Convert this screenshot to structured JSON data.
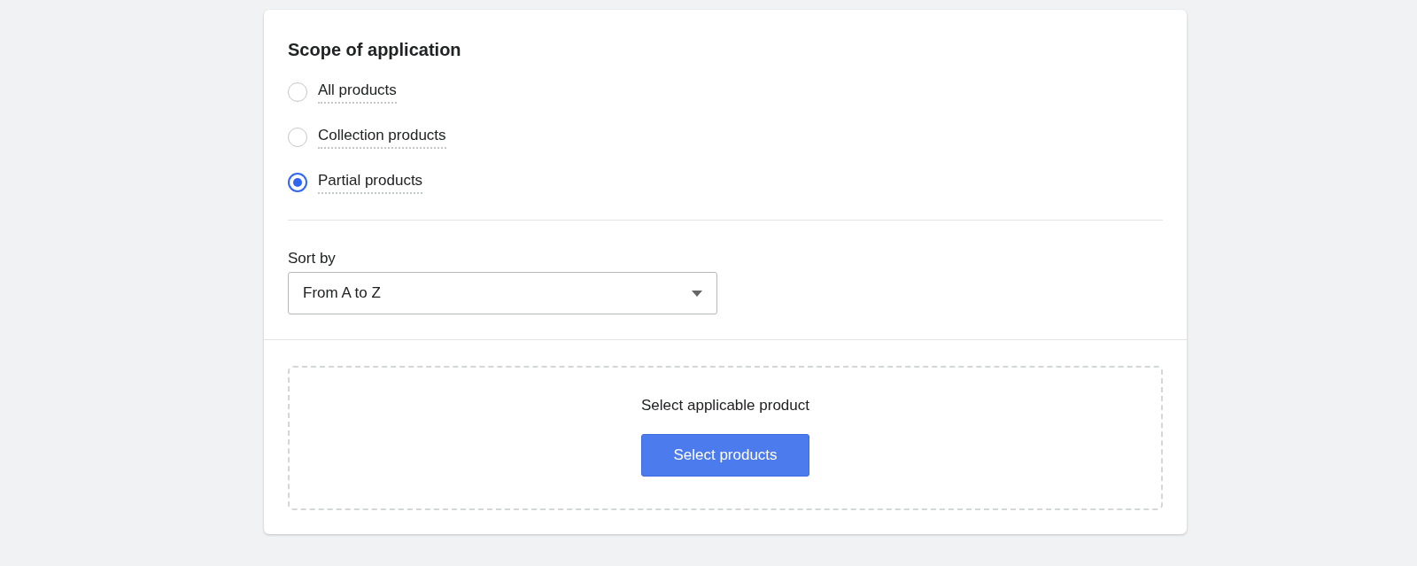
{
  "section": {
    "title": "Scope of application",
    "options": [
      {
        "label": "All products",
        "selected": false
      },
      {
        "label": "Collection products",
        "selected": false
      },
      {
        "label": "Partial products",
        "selected": true
      }
    ],
    "sort": {
      "label": "Sort by",
      "value": "From A to Z"
    }
  },
  "picker": {
    "prompt": "Select applicable product",
    "button": "Select products"
  }
}
